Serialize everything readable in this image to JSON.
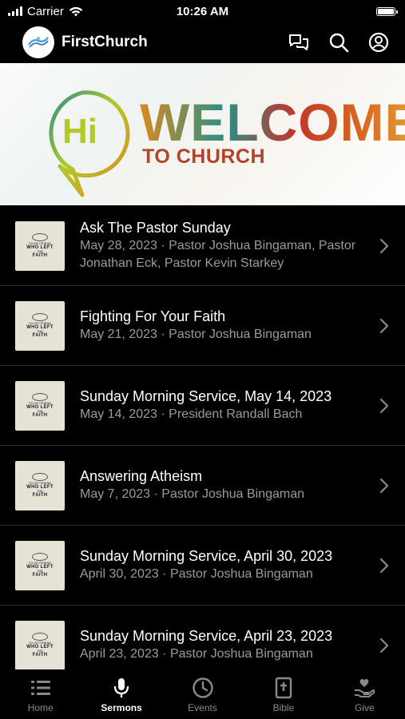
{
  "status_bar": {
    "carrier": "Carrier",
    "time": "10:26 AM"
  },
  "header": {
    "title": "FirstChurch",
    "actions": [
      {
        "icon": "chat-bubbles-icon"
      },
      {
        "icon": "search-icon"
      },
      {
        "icon": "profile-icon"
      }
    ]
  },
  "hero": {
    "badge": "Hi",
    "title": "WELCOME",
    "subtitle": "TO CHURCH",
    "colors": [
      "#d98a1e",
      "#2b8f86",
      "#c2362b",
      "#b4c829"
    ]
  },
  "thumbnail": {
    "lines": [
      "TO MY FRIEND",
      "WHO LEFT",
      "THE",
      "FAITH"
    ]
  },
  "sermons": [
    {
      "title": "Ask The Pastor Sunday",
      "meta": "May 28, 2023 · Pastor Joshua Bingaman, Pastor Jonathan Eck, Pastor Kevin Starkey"
    },
    {
      "title": "Fighting For Your Faith",
      "meta": "May 21, 2023 · Pastor Joshua Bingaman"
    },
    {
      "title": "Sunday Morning Service, May 14, 2023",
      "meta": "May 14, 2023 · President Randall Bach"
    },
    {
      "title": "Answering Atheism",
      "meta": "May 7, 2023 · Pastor Joshua Bingaman"
    },
    {
      "title": "Sunday Morning Service, April 30, 2023",
      "meta": "April 30, 2023 · Pastor Joshua Bingaman"
    },
    {
      "title": "Sunday Morning Service, April 23, 2023",
      "meta": "April 23, 2023 · Pastor Joshua Bingaman"
    }
  ],
  "tabs": [
    {
      "label": "Home",
      "icon": "list-icon",
      "active": false
    },
    {
      "label": "Sermons",
      "icon": "microphone-icon",
      "active": true
    },
    {
      "label": "Events",
      "icon": "clock-icon",
      "active": false
    },
    {
      "label": "Bible",
      "icon": "bible-icon",
      "active": false
    },
    {
      "label": "Give",
      "icon": "give-hand-heart-icon",
      "active": false
    }
  ]
}
